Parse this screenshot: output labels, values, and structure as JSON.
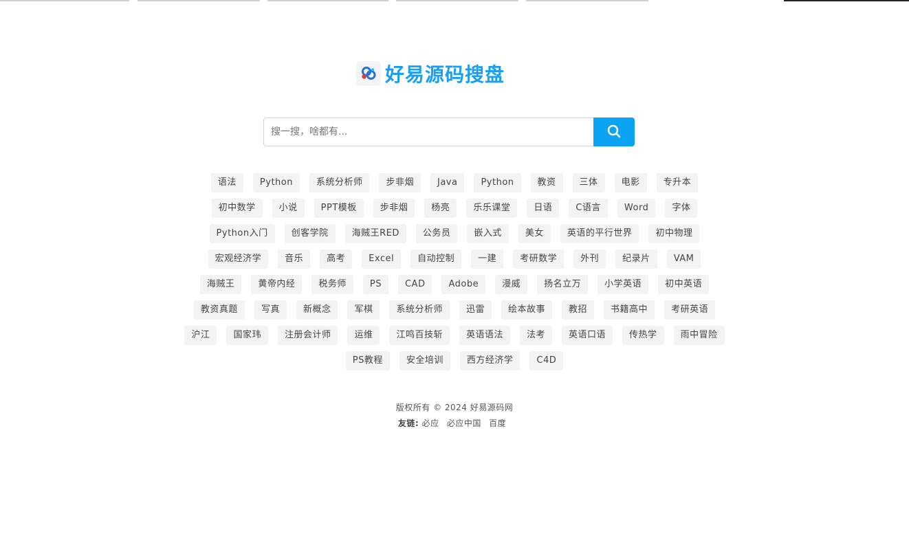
{
  "header": {
    "site_title": "好易源码搜盘",
    "logo_icon": "cloud-link-icon"
  },
  "search": {
    "placeholder": "搜一搜，啥都有...",
    "value": "",
    "button_icon": "search-icon",
    "accent_color": "#0aa4f2"
  },
  "tags": {
    "rows": [
      [
        "语法",
        "Python",
        "系统分析师",
        "步非烟",
        "Java",
        "Python",
        "教资",
        "三体",
        "电影",
        "专升本"
      ],
      [
        "初中数学",
        "小说",
        "PPT模板",
        "步非烟",
        "杨亮",
        "乐乐课堂",
        "日语",
        "C语言",
        "Word",
        "字体"
      ],
      [
        "Python入门",
        "创客学院",
        "海贼王RED",
        "公务员",
        "嵌入式",
        "美女",
        "英语的平行世界",
        "初中物理"
      ],
      [
        "宏观经济学",
        "音乐",
        "高考",
        "Excel",
        "自动控制",
        "一建",
        "考研数学",
        "外刊",
        "纪录片",
        "VAM"
      ],
      [
        "海贼王",
        "黄帝内经",
        "税务师",
        "PS",
        "CAD",
        "Adobe",
        "漫威",
        "扬名立万",
        "小学英语",
        "初中英语"
      ],
      [
        "教资真题",
        "写真",
        "新概念",
        "军棋",
        "系统分析师",
        "迅雷",
        "绘本故事",
        "教招",
        "书籍高中",
        "考研英语"
      ],
      [
        "沪江",
        "国家玮",
        "注册会计师",
        "运维",
        "江鸣百技斩",
        "英语语法",
        "法考",
        "英语口语",
        "传热学",
        "雨中冒险"
      ],
      [
        "PS教程",
        "安全培训",
        "西方经济学",
        "C4D"
      ]
    ]
  },
  "footer": {
    "copyright": "版权所有 © 2024 好易源码网",
    "friend_label": "友链:",
    "friend_links": [
      "必应",
      "必应中国",
      "百度"
    ]
  }
}
